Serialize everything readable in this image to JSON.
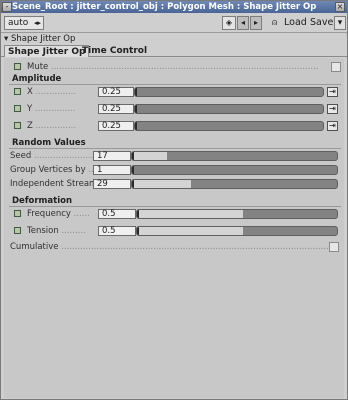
{
  "titlebar": {
    "title": "Scene_Root : jitter_control_obj : Polygon Mesh : Shape Jitter Op"
  },
  "toolbar": {
    "auto_label": "auto",
    "load_label": "Load",
    "save_label": "Save"
  },
  "property": {
    "header": "Shape Jitter Op"
  },
  "tabs": [
    {
      "label": "Shape Jitter Op"
    },
    {
      "label": "Time Control"
    }
  ],
  "mute": {
    "label": "Mute"
  },
  "amplitude": {
    "title": "Amplitude",
    "x": {
      "label": "X",
      "value": "0.25"
    },
    "y": {
      "label": "Y",
      "value": "0.25"
    },
    "z": {
      "label": "Z",
      "value": "0.25"
    }
  },
  "random": {
    "title": "Random Values",
    "seed": {
      "label": "Seed",
      "value": "17"
    },
    "group_vertices": {
      "label": "Group Vertices by",
      "value": "1"
    },
    "independent_streams": {
      "label": "Independent Streams",
      "value": "29"
    }
  },
  "deformation": {
    "title": "Deformation",
    "frequency": {
      "label": "Frequency",
      "value": "0.5"
    },
    "tension": {
      "label": "Tension",
      "value": "0.5"
    }
  },
  "cumulative": {
    "label": "Cumulative"
  }
}
